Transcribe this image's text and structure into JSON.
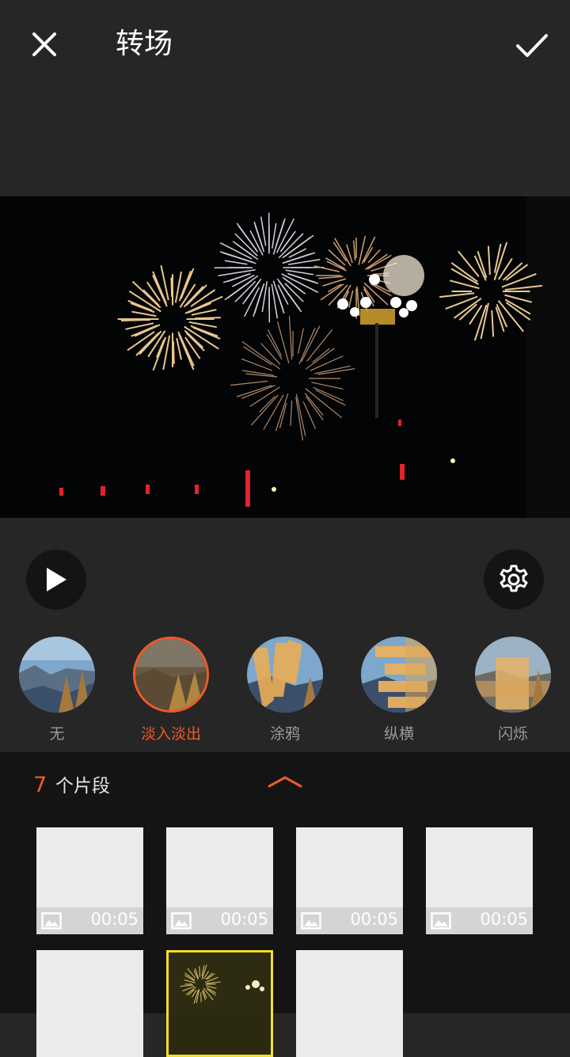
{
  "header": {
    "title": "转场",
    "close_icon": "close-icon",
    "confirm_icon": "checkmark-icon"
  },
  "preview": {
    "content": "fireworks-video-frame"
  },
  "controls": {
    "play_icon": "play-icon",
    "settings_icon": "gear-icon"
  },
  "transitions": {
    "selected_index": 1,
    "items": [
      {
        "label": "无"
      },
      {
        "label": "淡入淡出"
      },
      {
        "label": "涂鸦"
      },
      {
        "label": "纵横"
      },
      {
        "label": "闪烁"
      }
    ]
  },
  "clips": {
    "count": "7",
    "label": "个片段",
    "expand_icon": "chevron-up-icon",
    "items": [
      {
        "duration": "00:05"
      },
      {
        "duration": "00:05"
      },
      {
        "duration": "00:05"
      },
      {
        "duration": "00:05"
      },
      {
        "duration": ""
      },
      {
        "duration": ""
      },
      {
        "duration": ""
      }
    ],
    "active_index": 5
  },
  "colors": {
    "accent": "#f05a28",
    "highlight": "#f5dd2c",
    "background": "#262626",
    "panel": "#141414"
  }
}
